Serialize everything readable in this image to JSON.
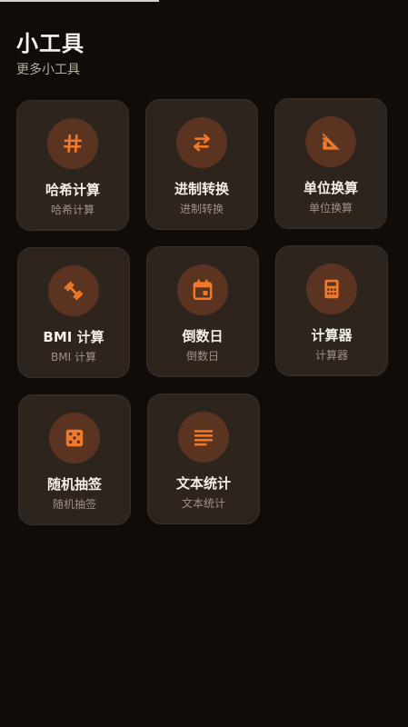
{
  "header": {
    "title": "小工具",
    "subtitle": "更多小工具"
  },
  "colors": {
    "background": "#0f0c09",
    "card": "#2c241d",
    "icon_circle": "#5a3420",
    "accent": "#f07a2a"
  },
  "tools": [
    {
      "title": "哈希计算",
      "subtitle": "哈希计算",
      "icon": "hash-icon"
    },
    {
      "title": "进制转换",
      "subtitle": "进制转换",
      "icon": "swap-arrows-icon"
    },
    {
      "title": "单位换算",
      "subtitle": "单位换算",
      "icon": "set-square-ruler-icon"
    },
    {
      "title": "BMI 计算",
      "subtitle": "BMI 计算",
      "icon": "dumbbell-icon"
    },
    {
      "title": "倒数日",
      "subtitle": "倒数日",
      "icon": "calendar-icon"
    },
    {
      "title": "计算器",
      "subtitle": "计算器",
      "icon": "calculator-icon"
    },
    {
      "title": "随机抽签",
      "subtitle": "随机抽签",
      "icon": "dice-icon"
    },
    {
      "title": "文本统计",
      "subtitle": "文本统计",
      "icon": "text-lines-icon"
    }
  ]
}
